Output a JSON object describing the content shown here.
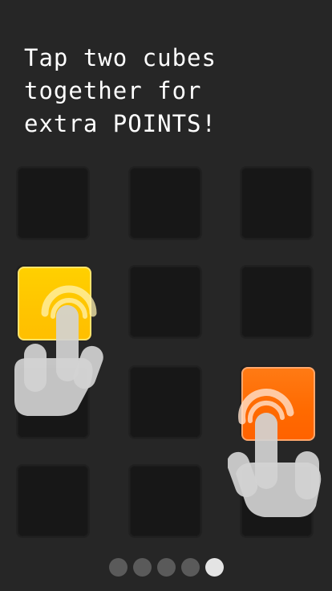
{
  "instruction": {
    "line1": "Tap two cubes",
    "line2": "together for",
    "line3": "extra POINTS!"
  },
  "colors": {
    "background": "#262626",
    "empty_cell": "#171717",
    "cube_yellow": "#ffc400",
    "cube_orange": "#ff6a00",
    "dot_inactive": "#5a5a5a",
    "dot_active": "#e4e4e4"
  },
  "grid": {
    "rows": 4,
    "cols": 3,
    "highlighted_cubes": [
      {
        "row": 2,
        "col": 1,
        "color": "yellow"
      },
      {
        "row": 3,
        "col": 3,
        "color": "orange"
      }
    ]
  },
  "icons": {
    "hand": "tap-hand-icon"
  },
  "pagination": {
    "total_pages": 5,
    "current_page": 5
  }
}
